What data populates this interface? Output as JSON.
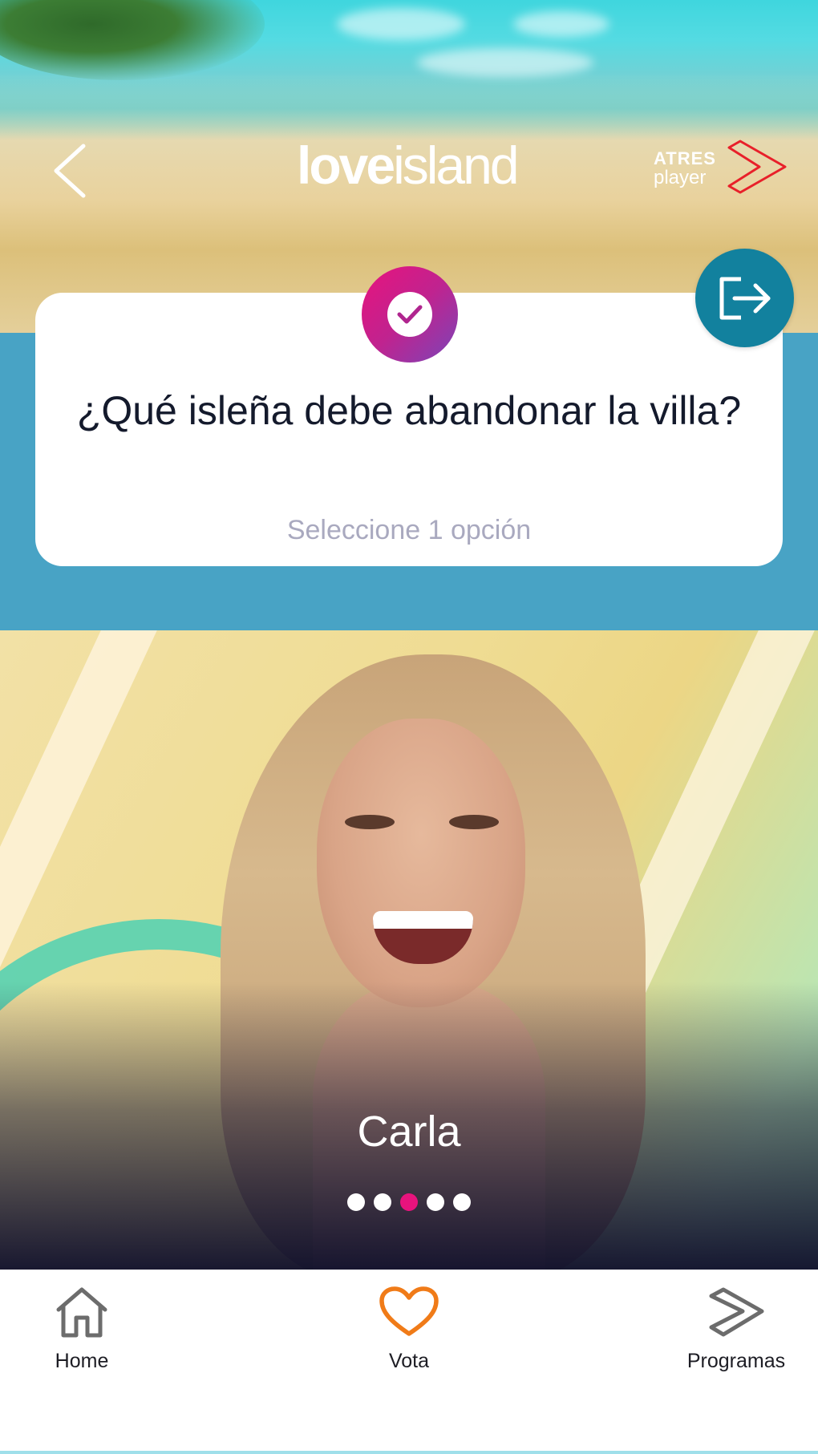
{
  "header": {
    "back_icon": "chevron-left-icon",
    "logo": {
      "word1": "love",
      "word2": "island"
    },
    "partner_logo": {
      "line1": "ATRES",
      "line2": "player"
    },
    "logout_icon": "logout-icon"
  },
  "question_card": {
    "badge_icon": "check-icon",
    "question": "¿Qué isleña debe abandonar la villa?",
    "hint": "Seleccione 1 opción"
  },
  "carousel": {
    "current_name": "Carla",
    "slide_count": 5,
    "active_index": 2
  },
  "tabbar": {
    "items": [
      {
        "label": "Home",
        "icon": "home-icon"
      },
      {
        "label": "Vota",
        "icon": "heart-icon"
      },
      {
        "label": "Programas",
        "icon": "programs-icon"
      }
    ]
  },
  "colors": {
    "accent_pink": "#e8137d",
    "band_blue": "#48a3c5",
    "logout_teal": "#12819e",
    "vote_orange": "#f07b18"
  }
}
